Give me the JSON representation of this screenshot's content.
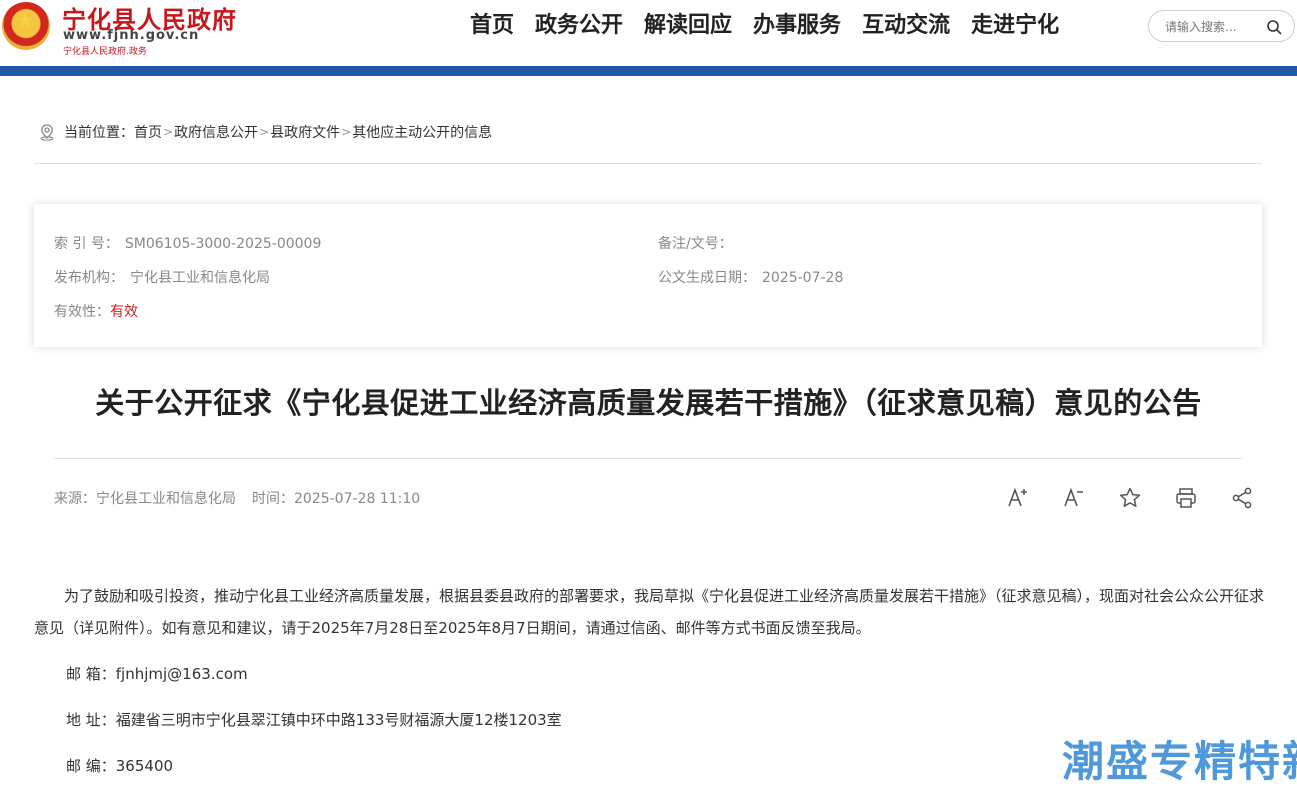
{
  "header": {
    "site_title": "宁化县人民政府",
    "site_url": "www.fjnh.gov.cn",
    "site_sub": "宁化县人民政府.政务",
    "nav": [
      "首页",
      "政务公开",
      "解读回应",
      "办事服务",
      "互动交流",
      "走进宁化"
    ],
    "search_placeholder": "请输入搜索..."
  },
  "breadcrumb": {
    "prefix": "当前位置：",
    "items": [
      "首页",
      "政府信息公开",
      "县政府文件",
      "其他应主动公开的信息"
    ],
    "separator": ">"
  },
  "info": {
    "index_label": "索 引 号：",
    "index_value": "SM06105-3000-2025-00009",
    "note_label": "备注/文号：",
    "note_value": "",
    "publisher_label": "发布机构：",
    "publisher_value": "宁化县工业和信息化局",
    "date_label": "公文生成日期：",
    "date_value": "2025-07-28",
    "validity_label": "有效性：",
    "validity_value": "有效"
  },
  "article": {
    "title": "关于公开征求《宁化县促进工业经济高质量发展若干措施》（征求意见稿）意见的公告",
    "source_label": "来源：",
    "source_value": "宁化县工业和信息化局",
    "time_label": "时间：",
    "time_value": "2025-07-28 11:10",
    "paragraph": "为了鼓励和吸引投资，推动宁化县工业经济高质量发展，根据县委县政府的部署要求，我局草拟《宁化县促进工业经济高质量发展若干措施》（征求意见稿），现面对社会公众公开征求意见（详见附件）。如有意见和建议，请于2025年7月28日至2025年8月7日期间，请通过信函、邮件等方式书面反馈至我局。",
    "email_line": "邮 箱：fjnhjmj@163.com",
    "address_line": "地 址：福建省三明市宁化县翠江镇中环中路133号财福源大厦12楼1203室",
    "postcode_line": "邮 编：365400"
  },
  "tools": [
    "font-increase-icon",
    "font-decrease-icon",
    "favorite-star-icon",
    "print-icon",
    "share-icon"
  ],
  "watermark": "潮盛专精特新",
  "colors": {
    "brand_red": "#c8161d",
    "nav_blue_bar": "#1e5aa8",
    "validity_red": "#d42020",
    "watermark_blue": "#3d8fd6"
  }
}
